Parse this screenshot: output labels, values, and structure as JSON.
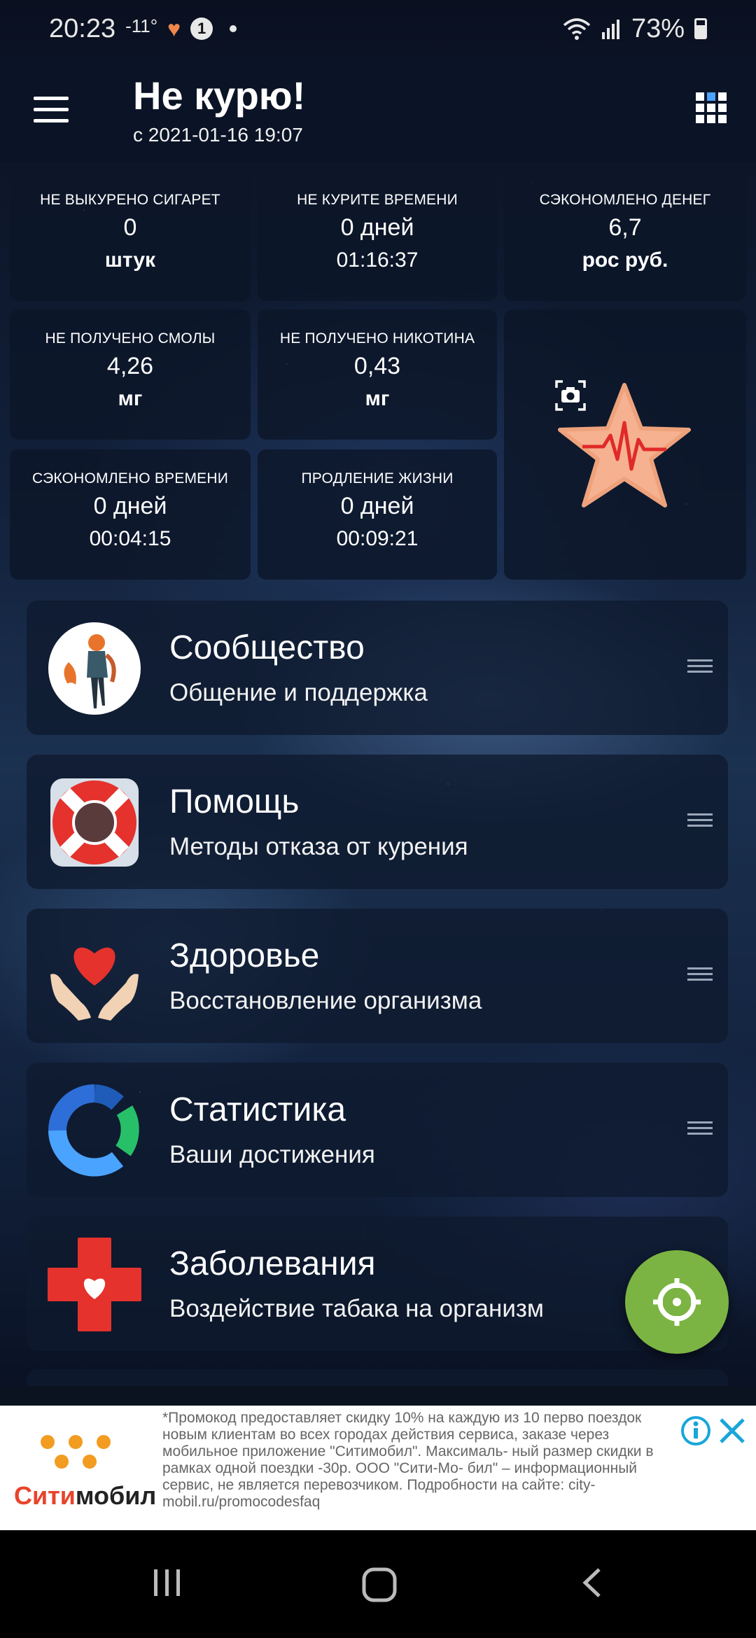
{
  "status_bar": {
    "time": "20:23",
    "temperature": "-11°",
    "notification_badge": "1",
    "battery": "73%"
  },
  "app_bar": {
    "title": "Не курю!",
    "subtitle": "с 2021-01-16 19:07"
  },
  "stats": {
    "cigs": {
      "label": "НЕ ВЫКУРЕНО СИГАРЕТ",
      "value": "0",
      "unit": "штук"
    },
    "time": {
      "label": "НЕ КУРИТЕ ВРЕМЕНИ",
      "value": "0 дней",
      "unit": "01:16:37"
    },
    "money": {
      "label": "СЭКОНОМЛЕНО ДЕНЕГ",
      "value": "6,7",
      "unit": "рос руб."
    },
    "tar": {
      "label": "НЕ ПОЛУЧЕНО СМОЛЫ",
      "value": "4,26",
      "unit": "мг"
    },
    "nicotine": {
      "label": "НЕ ПОЛУЧЕНО НИКОТИНА",
      "value": "0,43",
      "unit": "мг"
    },
    "saved_time": {
      "label": "СЭКОНОМЛЕНО ВРЕМЕНИ",
      "value": "0 дней",
      "unit": "00:04:15"
    },
    "life": {
      "label": "ПРОДЛЕНИЕ ЖИЗНИ",
      "value": "0 дней",
      "unit": "00:09:21"
    }
  },
  "menu": [
    {
      "title": "Сообщество",
      "subtitle": "Общение и поддержка",
      "icon": "community-avatar-icon"
    },
    {
      "title": "Помощь",
      "subtitle": "Методы отказа от курения",
      "icon": "lifebuoy-icon"
    },
    {
      "title": "Здоровье",
      "subtitle": "Восстановление организма",
      "icon": "heart-hands-icon"
    },
    {
      "title": "Статистика",
      "subtitle": "Ваши достижения",
      "icon": "statistics-ring-icon"
    },
    {
      "title": "Заболевания",
      "subtitle": "Воздействие табака на организм",
      "icon": "medical-cross-icon"
    }
  ],
  "ad": {
    "brand_prefix": "Сити",
    "brand_suffix": "мобил",
    "text": "*Промокод предоставляет скидку 10% на каждую из 10 перво поездок новым клиентам во всех городах действия сервиса, заказе через мобильное приложение \"Ситимобил\". Максималь- ный размер скидки в рамках одной поездки -30р. ООО \"Сити-Мо- бил\" – информационный сервис, не является перевозчиком. Подробности на сайте: city-mobil.ru/promocodesfaq"
  },
  "colors": {
    "accent_green": "#7bb443",
    "tile_bg": "#0c1628",
    "star": "#f6b190",
    "pulse": "#e02a2a"
  }
}
